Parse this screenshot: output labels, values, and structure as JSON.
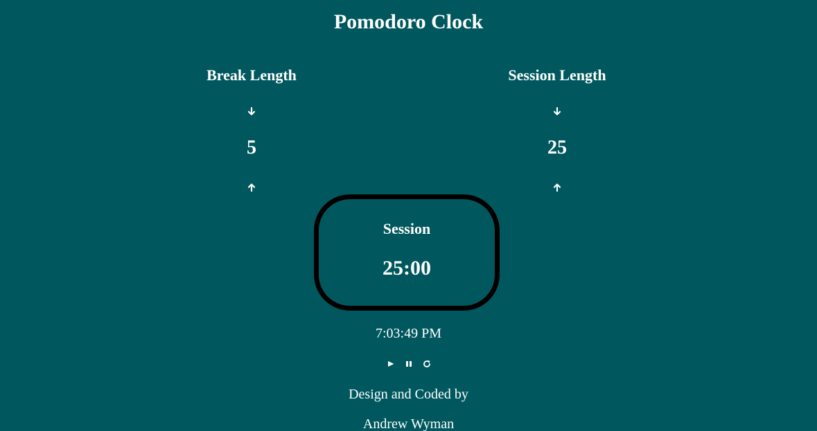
{
  "app": {
    "title": "Pomodoro Clock"
  },
  "break_control": {
    "label": "Break Length",
    "value": "5",
    "decrement_icon": "arrow-down-icon",
    "increment_icon": "arrow-up-icon"
  },
  "session_control": {
    "label": "Session Length",
    "value": "25",
    "decrement_icon": "arrow-down-icon",
    "increment_icon": "arrow-up-icon"
  },
  "timer": {
    "label": "Session",
    "time": "25:00"
  },
  "clock": {
    "time": "7:03:49 PM"
  },
  "media_controls": {
    "play_icon": "play-icon",
    "pause_icon": "pause-icon",
    "reset_icon": "refresh-icon"
  },
  "footer": {
    "line1": "Design and Coded by",
    "line2": "Andrew Wyman"
  },
  "colors": {
    "background": "#00585E",
    "text": "#FFFFFF",
    "timer_border": "#000000"
  }
}
